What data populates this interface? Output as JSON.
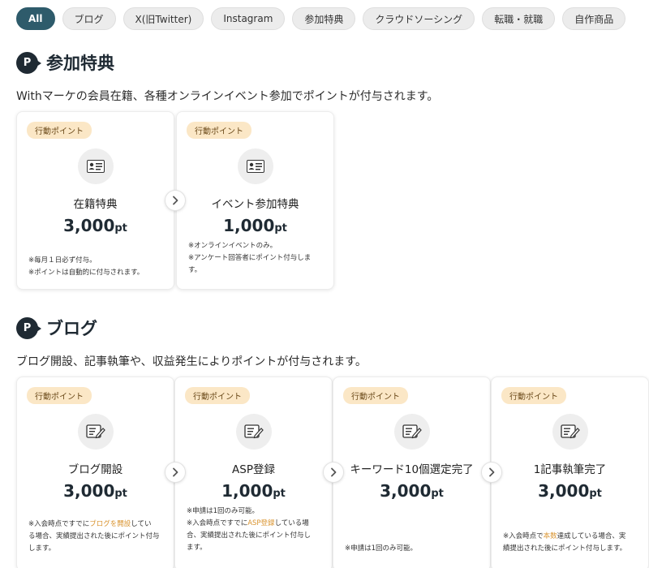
{
  "tabs": [
    "All",
    "ブログ",
    "X(旧Twitter)",
    "Instagram",
    "参加特典",
    "クラウドソーシング",
    "転職・就職",
    "自作商品"
  ],
  "sections": [
    {
      "badge": "P",
      "title": "参加特典",
      "desc": "Withマーケの会員在籍、各種オンラインイベント参加でポイントが付与されます。",
      "cards": [
        {
          "tag": "行動ポイント",
          "title": "在籍特典",
          "points": "3,000",
          "unit": "pt",
          "note_lines": [
            "※毎月１日必ず付与。",
            "※ポイントは自動的に付与されます。"
          ]
        },
        {
          "tag": "行動ポイント",
          "title": "イベント参加特典",
          "points": "1,000",
          "unit": "pt",
          "note_lines": [
            "※オンラインイベントのみ。",
            "※アンケート回答者にポイント付与しま",
            "す。"
          ]
        }
      ]
    },
    {
      "badge": "P",
      "title": "ブログ",
      "desc": "ブログ開設、記事執筆や、収益発生によりポイントが付与されます。",
      "cards": [
        {
          "tag": "行動ポイント",
          "title": "ブログ開設",
          "points": "3,000",
          "unit": "pt",
          "note": {
            "pre": "※入会時点ですでに",
            "hl": "ブログを開設",
            "post": "してい",
            "line2": "る場合、実績提出された後にポイント付与",
            "line3": "します。"
          }
        },
        {
          "tag": "行動ポイント",
          "title": "ASP登録",
          "points": "1,000",
          "unit": "pt",
          "note_first": "※申請は1回のみ可能。",
          "note": {
            "pre": "※入会時点ですでに",
            "hl": "ASP登録",
            "post": "している場",
            "line2": "合、実績提出された後にポイント付与し",
            "line3": "ます。"
          }
        },
        {
          "tag": "行動ポイント",
          "title": "キーワード10個選定完了",
          "points": "3,000",
          "unit": "pt",
          "note_lines": [
            "※申請は1回のみ可能。"
          ]
        },
        {
          "tag": "行動ポイント",
          "title": "1記事執筆完了",
          "points": "3,000",
          "unit": "pt",
          "note": {
            "pre": "※入会時点で",
            "hl": "本数",
            "post": "達成している場合、実",
            "line2": "績提出された後にポイント付与します。"
          }
        }
      ]
    }
  ],
  "colors": {
    "active_chip": "#2e5b6b",
    "tag_bg": "#fbe7c6",
    "highlight": "#d9932e",
    "badge": "#1f2a33"
  },
  "icons": {
    "card1": "id-card-icon",
    "card2": "document-edit-icon",
    "arrow": "chevron-right-icon"
  }
}
